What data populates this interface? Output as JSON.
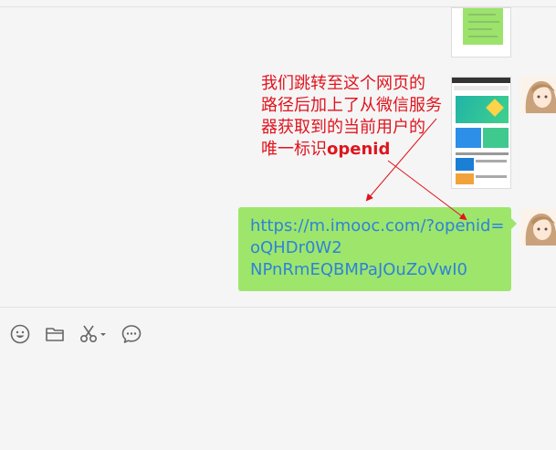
{
  "chat": {
    "message_url": {
      "line1": "https://m.imooc.com/?openid=",
      "line2": "oQHDr0W2",
      "line3": "NPnRmEQBMPaJOuZoVwI0"
    },
    "annotation": {
      "line1": "我们跳转至这个网页的",
      "line2": "路径后加上了从微信服务",
      "line3": "器获取到的当前用户的",
      "line4_prefix": "唯一标识",
      "line4_bold": "openid"
    }
  },
  "toolbar": {
    "icons": [
      "emoji-icon",
      "folder-icon",
      "scissors-icon",
      "chat-bubble-icon"
    ]
  },
  "colors": {
    "bubble": "#9de66b",
    "link_text": "#2f82d8",
    "annotation": "#e0141e",
    "background": "#f5f5f5"
  }
}
